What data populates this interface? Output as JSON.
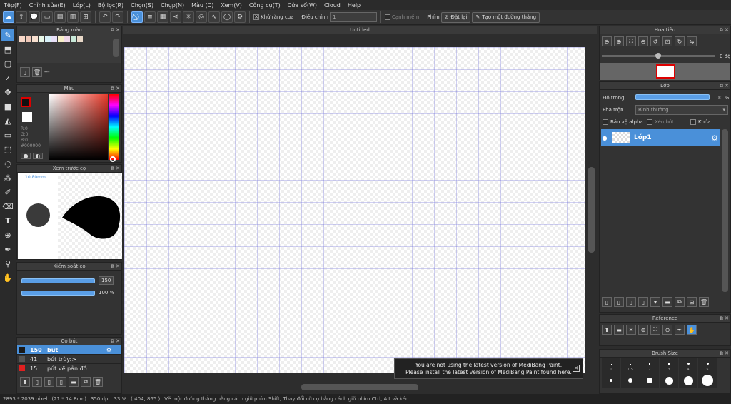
{
  "menu": [
    "Tệp(F)",
    "Chỉnh sửa(E)",
    "Lớp(L)",
    "Bộ lọc(R)",
    "Chọn(S)",
    "Chụp(N)",
    "Màu (C)",
    "Xem(V)",
    "Công cụ(T)",
    "Cửa sổ(W)",
    "Cloud",
    "Help"
  ],
  "toolbar": {
    "antialias_label": "Khử răng cưa",
    "adjust_label": "Điều chỉnh",
    "adjust_value": "1",
    "soft_edge_label": "Cạnh mềm",
    "key_label": "Phím",
    "reset_label": "Đặt lại",
    "make_line_label": "Tạo một đường thẳng"
  },
  "panels": {
    "palette_title": "Bảng màu",
    "palette_field": "---",
    "palette_colors": [
      "#f8d8c8",
      "#f0c8b8",
      "#f8e0d0",
      "#e8f8e8",
      "#d8f0f8",
      "#e8e0f8",
      "#f8f0c8",
      "#f0d8e8",
      "#c8e8d8",
      "#e8d8c8"
    ],
    "color_title": "Màu",
    "color_readout": [
      "R:0",
      "G:0",
      "B:0",
      "#000000"
    ],
    "preview_title": "Xem trước cọ",
    "preview_size": "10.80mm",
    "brush_control_title": "Kiểm soát cọ",
    "brush_size_value": "150",
    "brush_opacity_value": "100 %",
    "brush_title": "Cọ bút",
    "brushes": [
      {
        "size": "150",
        "name": "bút",
        "color": "#1a1a1a"
      },
      {
        "size": "41",
        "name": "bút trùy:>",
        "color": "#555555"
      },
      {
        "size": "15",
        "name": "pút vẽ pản đồ",
        "color": "#e02020"
      }
    ],
    "nav_title": "Hoa tiêu",
    "nav_angle": "0 độ",
    "layer_title": "Lớp",
    "opacity_label": "Độ trong",
    "opacity_value": "100 %",
    "blend_label": "Pha trộn",
    "blend_value": "Bình thường",
    "protect_alpha": "Bảo vệ alpha",
    "clip_label": "Xén bớt",
    "lock_label": "Khóa",
    "layer_name": "Lớp1",
    "reference_title": "Reference",
    "brushsize_title": "Brush Size",
    "brushsize_labels": [
      "1",
      "1.5",
      "2",
      "3",
      "4",
      "5"
    ]
  },
  "canvas": {
    "title": "Untitled"
  },
  "notice": {
    "line1": "You are not using the latest version of MediBang Paint.",
    "line2": "Please install the latest version of MediBang Paint found here."
  },
  "status": {
    "dims": "2893 * 2039 pixel",
    "cm": "(21 * 14.8cm)",
    "dpi": "350 dpi",
    "zoom": "33 %",
    "coords": "( 404, 865 )",
    "hint": "Vẽ một đường thẳng bằng cách giữ phím Shift, Thay đổi cỡ cọ bằng cách giữ phím Ctrl, Alt và kéo"
  }
}
